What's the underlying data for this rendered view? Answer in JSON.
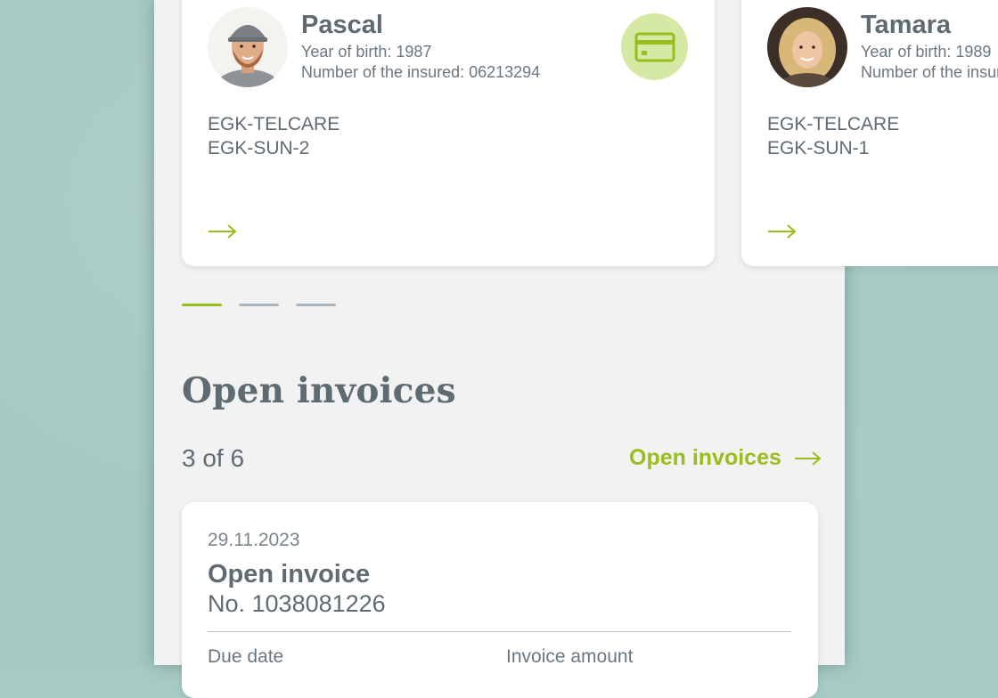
{
  "insured_cards": [
    {
      "name": "Pascal",
      "year_of_birth": "Year of birth: 1987",
      "insured_number": "Number of the insured: 06213294",
      "products": [
        "EGK-TELCARE",
        "EGK-SUN-2"
      ]
    },
    {
      "name": "Tamara",
      "year_of_birth": "Year of birth: 1989",
      "insured_number": "Number of the insured",
      "products": [
        "EGK-TELCARE",
        "EGK-SUN-1"
      ]
    }
  ],
  "carousel": {
    "total": 3,
    "active_index": 0
  },
  "invoices_section": {
    "title": "Open invoices",
    "count_text": "3 of 6",
    "link_label": "Open invoices"
  },
  "invoice": {
    "date": "29.11.2023",
    "title": "Open invoice",
    "number": "No. 1038081226",
    "due_label": "Due date",
    "amount_label": "Invoice amount"
  },
  "colors": {
    "accent": "#98bd1c",
    "accent_light": "#d6e9a4",
    "text": "#5f6b73",
    "background": "#a6cbc4"
  },
  "icons": {
    "card_action": "credit-card-icon",
    "navigate": "arrow-right-icon"
  }
}
